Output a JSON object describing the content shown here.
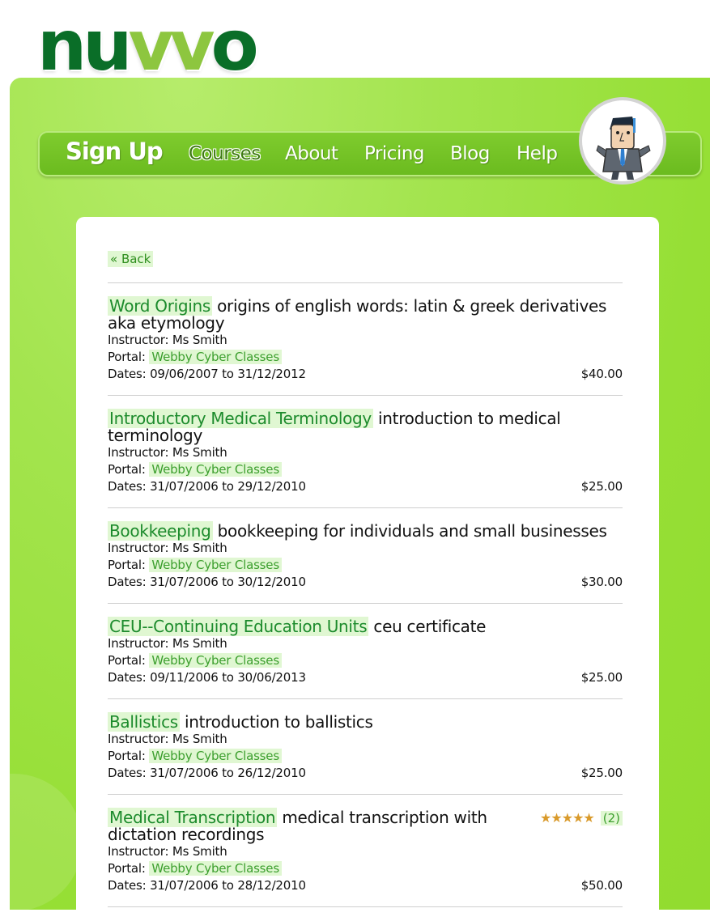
{
  "logo": {
    "part1": "nu",
    "part2": "vv",
    "part3": "o"
  },
  "nav": {
    "signup": "Sign Up",
    "courses": "Courses",
    "about": "About",
    "pricing": "Pricing",
    "blog": "Blog",
    "help": "Help"
  },
  "back_label": "« Back",
  "courses": [
    {
      "title": "Word Origins",
      "description": "origins of english words: latin & greek derivatives aka etymology",
      "instructor": "Instructor: Ms Smith",
      "portal_label": "Portal:",
      "portal": "Webby Cyber Classes",
      "dates": "Dates: 09/06/2007 to 31/12/2012",
      "price": "$40.00"
    },
    {
      "title": "Introductory Medical Terminology",
      "description": "introduction to medical terminology",
      "instructor": "Instructor: Ms Smith",
      "portal_label": "Portal:",
      "portal": "Webby Cyber Classes",
      "dates": "Dates: 31/07/2006 to 29/12/2010",
      "price": "$25.00"
    },
    {
      "title": "Bookkeeping",
      "description": "bookkeeping for individuals and small businesses",
      "instructor": "Instructor: Ms Smith",
      "portal_label": "Portal:",
      "portal": "Webby Cyber Classes",
      "dates": "Dates: 31/07/2006 to 30/12/2010",
      "price": "$30.00"
    },
    {
      "title": "CEU--Continuing Education Units",
      "description": "ceu certificate",
      "instructor": "Instructor: Ms Smith",
      "portal_label": "Portal:",
      "portal": "Webby Cyber Classes",
      "dates": "Dates: 09/11/2006 to 30/06/2013",
      "price": "$25.00"
    },
    {
      "title": "Ballistics",
      "description": "introduction to ballistics",
      "instructor": "Instructor: Ms Smith",
      "portal_label": "Portal:",
      "portal": "Webby Cyber Classes",
      "dates": "Dates: 31/07/2006 to 26/12/2010",
      "price": "$25.00"
    },
    {
      "title": "Medical Transcription",
      "description": "medical transcription with dictation recordings",
      "instructor": "Instructor: Ms Smith",
      "portal_label": "Portal:",
      "portal": "Webby Cyber Classes",
      "dates": "Dates: 31/07/2006 to 28/12/2010",
      "price": "$50.00",
      "rating_stars": 5,
      "rating_count": "(2)"
    }
  ],
  "colors": {
    "brand_dark_green": "#0a6e28",
    "brand_light_green": "#8dc63f",
    "background_green": "#9be03c",
    "link_highlight": "#e0f7d2",
    "link_text": "#1c8b2c"
  }
}
